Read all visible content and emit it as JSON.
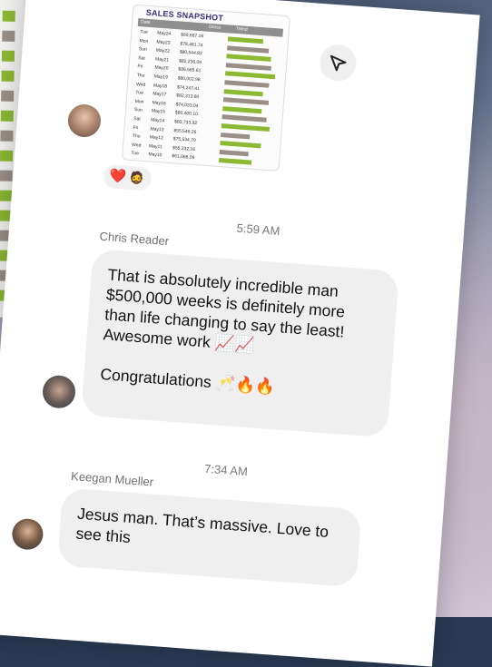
{
  "background": {
    "sheet_bars": [
      "#8cb832",
      "#9a8f88",
      "#8cb832",
      "#8cb832",
      "#9a8f88",
      "#8cb832",
      "#9a8f88",
      "#8cb832",
      "#9a8f88",
      "#8cb832",
      "#8cb832",
      "#9a8f88",
      "#8cb832",
      "#9a8f88",
      "#8cb832"
    ]
  },
  "shared_image": {
    "title": "SALES SNAPSHOT",
    "headers": [
      "Date",
      "Gross",
      "Trend"
    ],
    "rows": [
      {
        "day": "Tue",
        "date": "May24",
        "amount": "$69,667.16",
        "bar_level": 0.55,
        "bar_color": "#8cb832"
      },
      {
        "day": "Mon",
        "date": "May23",
        "amount": "$78,461.74",
        "bar_level": 0.65,
        "bar_color": "#9a8f88"
      },
      {
        "day": "Sun",
        "date": "May22",
        "amount": "$80,544.82",
        "bar_level": 0.7,
        "bar_color": "#8cb832"
      },
      {
        "day": "Sat",
        "date": "May21",
        "amount": "$82,236.09",
        "bar_level": 0.72,
        "bar_color": "#9a8f88"
      },
      {
        "day": "Fri",
        "date": "May20",
        "amount": "$86,565.61",
        "bar_level": 0.78,
        "bar_color": "#8cb832"
      },
      {
        "day": "Thu",
        "date": "May19",
        "amount": "$80,002.98",
        "bar_level": 0.7,
        "bar_color": "#9a8f88"
      },
      {
        "day": "Wed",
        "date": "May18",
        "amount": "$74,247.41",
        "bar_level": 0.62,
        "bar_color": "#8cb832"
      },
      {
        "day": "Tue",
        "date": "May17",
        "amount": "$82,313.80",
        "bar_level": 0.72,
        "bar_color": "#9a8f88"
      },
      {
        "day": "Mon",
        "date": "May16",
        "amount": "$74,033.04",
        "bar_level": 0.62,
        "bar_color": "#8cb832"
      },
      {
        "day": "Sun",
        "date": "May15",
        "amount": "$80,400.10",
        "bar_level": 0.7,
        "bar_color": "#9a8f88"
      },
      {
        "day": "Sat",
        "date": "May14",
        "amount": "$83,733.92",
        "bar_level": 0.75,
        "bar_color": "#8cb832"
      },
      {
        "day": "Fri",
        "date": "May13",
        "amount": "$55,546.26",
        "bar_level": 0.45,
        "bar_color": "#9a8f88"
      },
      {
        "day": "Thu",
        "date": "May12",
        "amount": "$75,534.70",
        "bar_level": 0.64,
        "bar_color": "#8cb832"
      },
      {
        "day": "Wed",
        "date": "May11",
        "amount": "$55,232.16",
        "bar_level": 0.45,
        "bar_color": "#9a8f88"
      },
      {
        "day": "Tue",
        "date": "May10",
        "amount": "$61,066.09",
        "bar_level": 0.52,
        "bar_color": "#8cb832"
      }
    ]
  },
  "reactions": [
    "❤️",
    "🧔"
  ],
  "messages": [
    {
      "timestamp": "5:59 AM",
      "sender": "Chris Reader",
      "text_main": "That is absolutely incredible man $500,000 weeks is definitely more than life changing to say the least! Awesome work 📈📈",
      "text_secondary": "Congratulations 🥂🔥🔥"
    },
    {
      "timestamp": "7:34 AM",
      "sender": "Keegan Mueller",
      "text_main": "Jesus man. That’s massive. Love to see this"
    }
  ],
  "icons": {
    "share": "send-arrow-icon"
  }
}
